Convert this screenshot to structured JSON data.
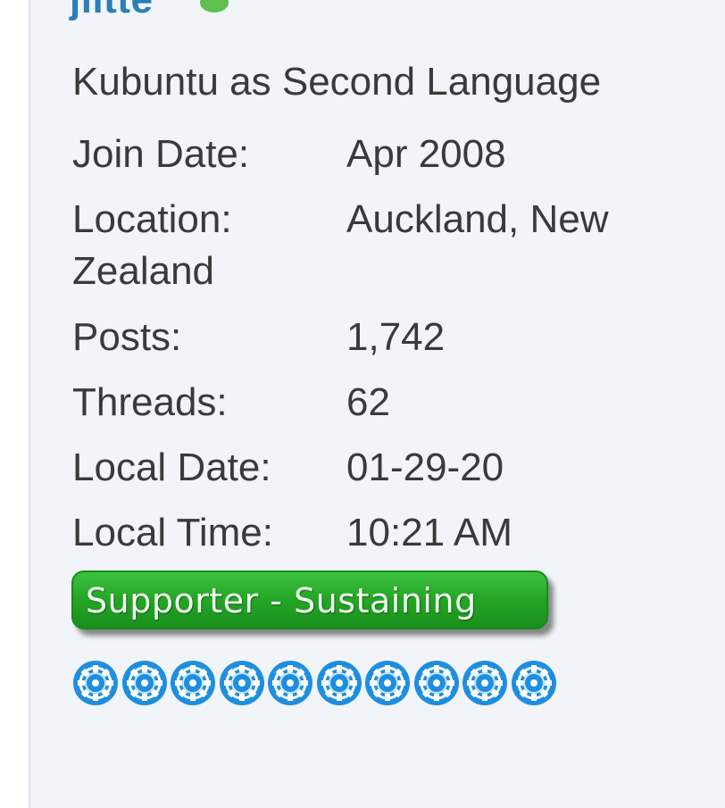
{
  "user": {
    "name": "jiltte",
    "title": "Kubuntu as Second Language"
  },
  "info": {
    "join_label": "Join Date:",
    "join_value": "Apr 2008",
    "location_label": "Location:",
    "location_value": "Auckland, New",
    "location_value_cont": "Zealand",
    "posts_label": "Posts:",
    "posts_value": "1,742",
    "threads_label": "Threads:",
    "threads_value": "62",
    "local_date_label": "Local Date:",
    "local_date_value": "01-29-20",
    "local_time_label": "Local Time:",
    "local_time_value": "10:21 AM"
  },
  "badge": {
    "label": "Supporter - Sustaining",
    "color": "#25a826"
  },
  "reputation": {
    "count": 10,
    "icon": "blue-gear-icon",
    "color": "#1e8ee0"
  }
}
